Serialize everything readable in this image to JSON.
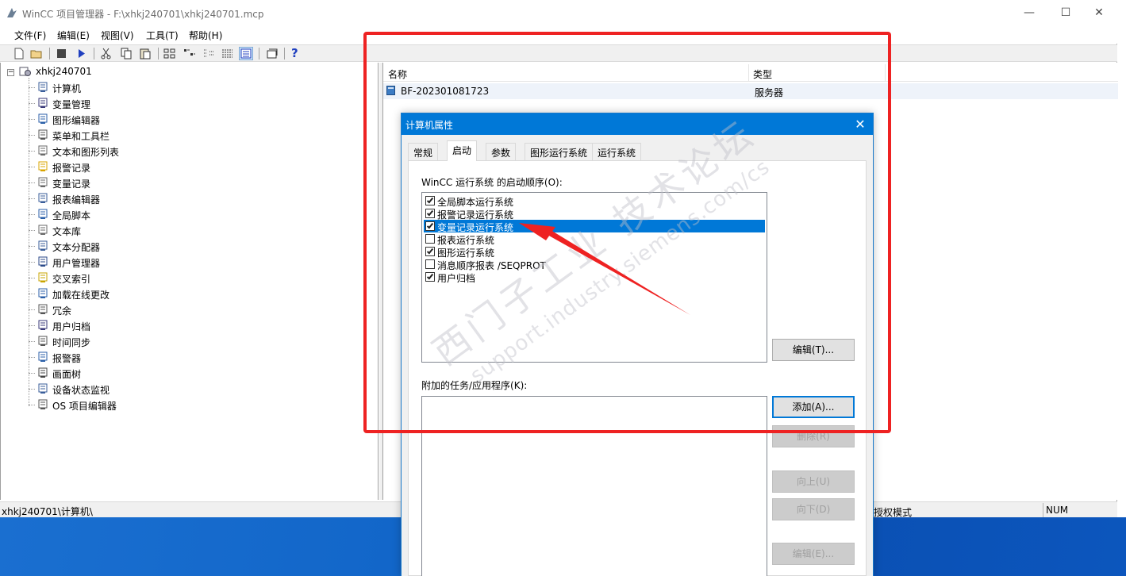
{
  "window": {
    "title": "WinCC 项目管理器 - F:\\xhkj240701\\xhkj240701.mcp",
    "controls": {
      "minimize": "—",
      "maximize": "☐",
      "close": "✕"
    }
  },
  "menu": [
    "文件(F)",
    "编辑(E)",
    "视图(V)",
    "工具(T)",
    "帮助(H)"
  ],
  "toolbar": {
    "help": "?"
  },
  "tree": {
    "expander": "−",
    "root": "xhkj240701",
    "items": [
      {
        "label": "计算机",
        "icon": "computer-icon"
      },
      {
        "label": "变量管理",
        "icon": "tag-management-icon"
      },
      {
        "label": "图形编辑器",
        "icon": "graphics-designer-icon"
      },
      {
        "label": "菜单和工具栏",
        "icon": "menus-toolbars-icon"
      },
      {
        "label": "文本和图形列表",
        "icon": "text-graphic-list-icon"
      },
      {
        "label": "报警记录",
        "icon": "alarm-logging-icon"
      },
      {
        "label": "变量记录",
        "icon": "tag-logging-icon"
      },
      {
        "label": "报表编辑器",
        "icon": "report-designer-icon"
      },
      {
        "label": "全局脚本",
        "icon": "global-script-icon"
      },
      {
        "label": "文本库",
        "icon": "text-library-icon"
      },
      {
        "label": "文本分配器",
        "icon": "text-distributor-icon"
      },
      {
        "label": "用户管理器",
        "icon": "user-administrator-icon"
      },
      {
        "label": "交叉索引",
        "icon": "cross-reference-icon"
      },
      {
        "label": "加载在线更改",
        "icon": "load-online-changes-icon"
      },
      {
        "label": "冗余",
        "icon": "redundancy-icon"
      },
      {
        "label": "用户归档",
        "icon": "user-archive-icon"
      },
      {
        "label": "时间同步",
        "icon": "time-sync-icon"
      },
      {
        "label": "报警器",
        "icon": "horn-icon"
      },
      {
        "label": "画面树",
        "icon": "picture-tree-icon"
      },
      {
        "label": "设备状态监视",
        "icon": "device-monitor-icon"
      },
      {
        "label": "OS 项目编辑器",
        "icon": "os-project-editor-icon"
      }
    ]
  },
  "list": {
    "columns": [
      "名称",
      "类型"
    ],
    "rows": [
      {
        "name": "BF-202301081723",
        "type": "服务器"
      }
    ]
  },
  "statusbar": {
    "path": "xhkj240701\\计算机\\",
    "mode": "授权模式",
    "num": "NUM"
  },
  "dialog": {
    "title": "计算机属性",
    "close": "✕",
    "tabs": [
      "常规",
      "启动",
      "参数",
      "图形运行系统",
      "运行系统"
    ],
    "active_tab": "启动",
    "startup_label": "WinCC 运行系统 的启动顺序(O):",
    "startup_items": [
      {
        "label": "全局脚本运行系统",
        "checked": true
      },
      {
        "label": "报警记录运行系统",
        "checked": true
      },
      {
        "label": "变量记录运行系统",
        "checked": true,
        "selected": true
      },
      {
        "label": "报表运行系统",
        "checked": false
      },
      {
        "label": "图形运行系统",
        "checked": true
      },
      {
        "label": "消息顺序报表 /SEQPROT",
        "checked": false
      },
      {
        "label": "用户归档",
        "checked": true
      }
    ],
    "edit_top": "编辑(T)...",
    "additional_label": "附加的任务/应用程序(K):",
    "add": "添加(A)...",
    "remove": "删除(R)",
    "up": "向上(U)",
    "down": "向下(D)",
    "edit_bottom": "编辑(E)..."
  },
  "watermark": {
    "line1": "西门子工业 技术论坛",
    "line2": "support.industry.siemens.com/cs"
  },
  "colors": {
    "selection": "#0078d7",
    "annotation": "#ee2222",
    "desktop": "#0a58c0"
  }
}
